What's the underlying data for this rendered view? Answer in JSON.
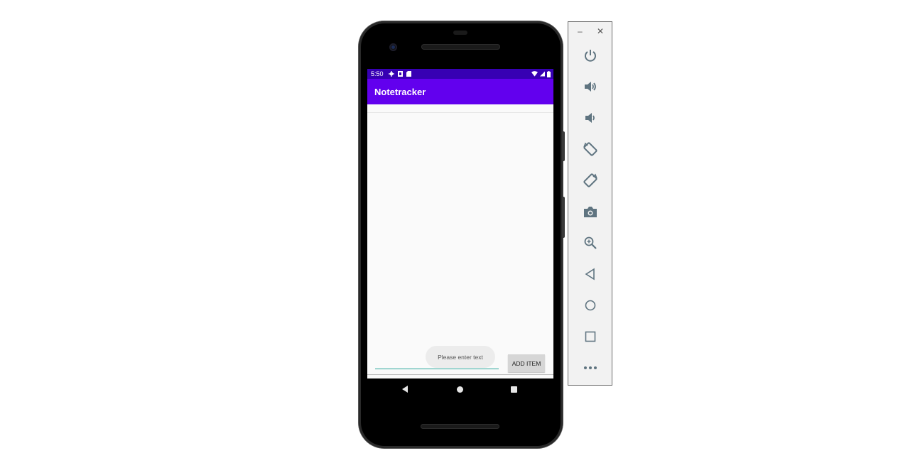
{
  "status_bar": {
    "time": "5:50"
  },
  "app": {
    "title": "Notetracker"
  },
  "input": {
    "placeholder": "Please enter text"
  },
  "add_button": {
    "label": "ADD ITEM"
  },
  "emulator_toolbar": {
    "minimize": "–",
    "close": "✕",
    "buttons": [
      "power-icon",
      "volume-up-icon",
      "volume-down-icon",
      "rotate-left-icon",
      "rotate-right-icon",
      "camera-icon",
      "zoom-icon",
      "back-icon",
      "home-icon",
      "overview-icon",
      "more-icon"
    ]
  },
  "colors": {
    "status_bar": "#3700b3",
    "app_bar": "#6200ee",
    "accent": "#26a69a",
    "toolbar_icon": "#5f7480"
  }
}
